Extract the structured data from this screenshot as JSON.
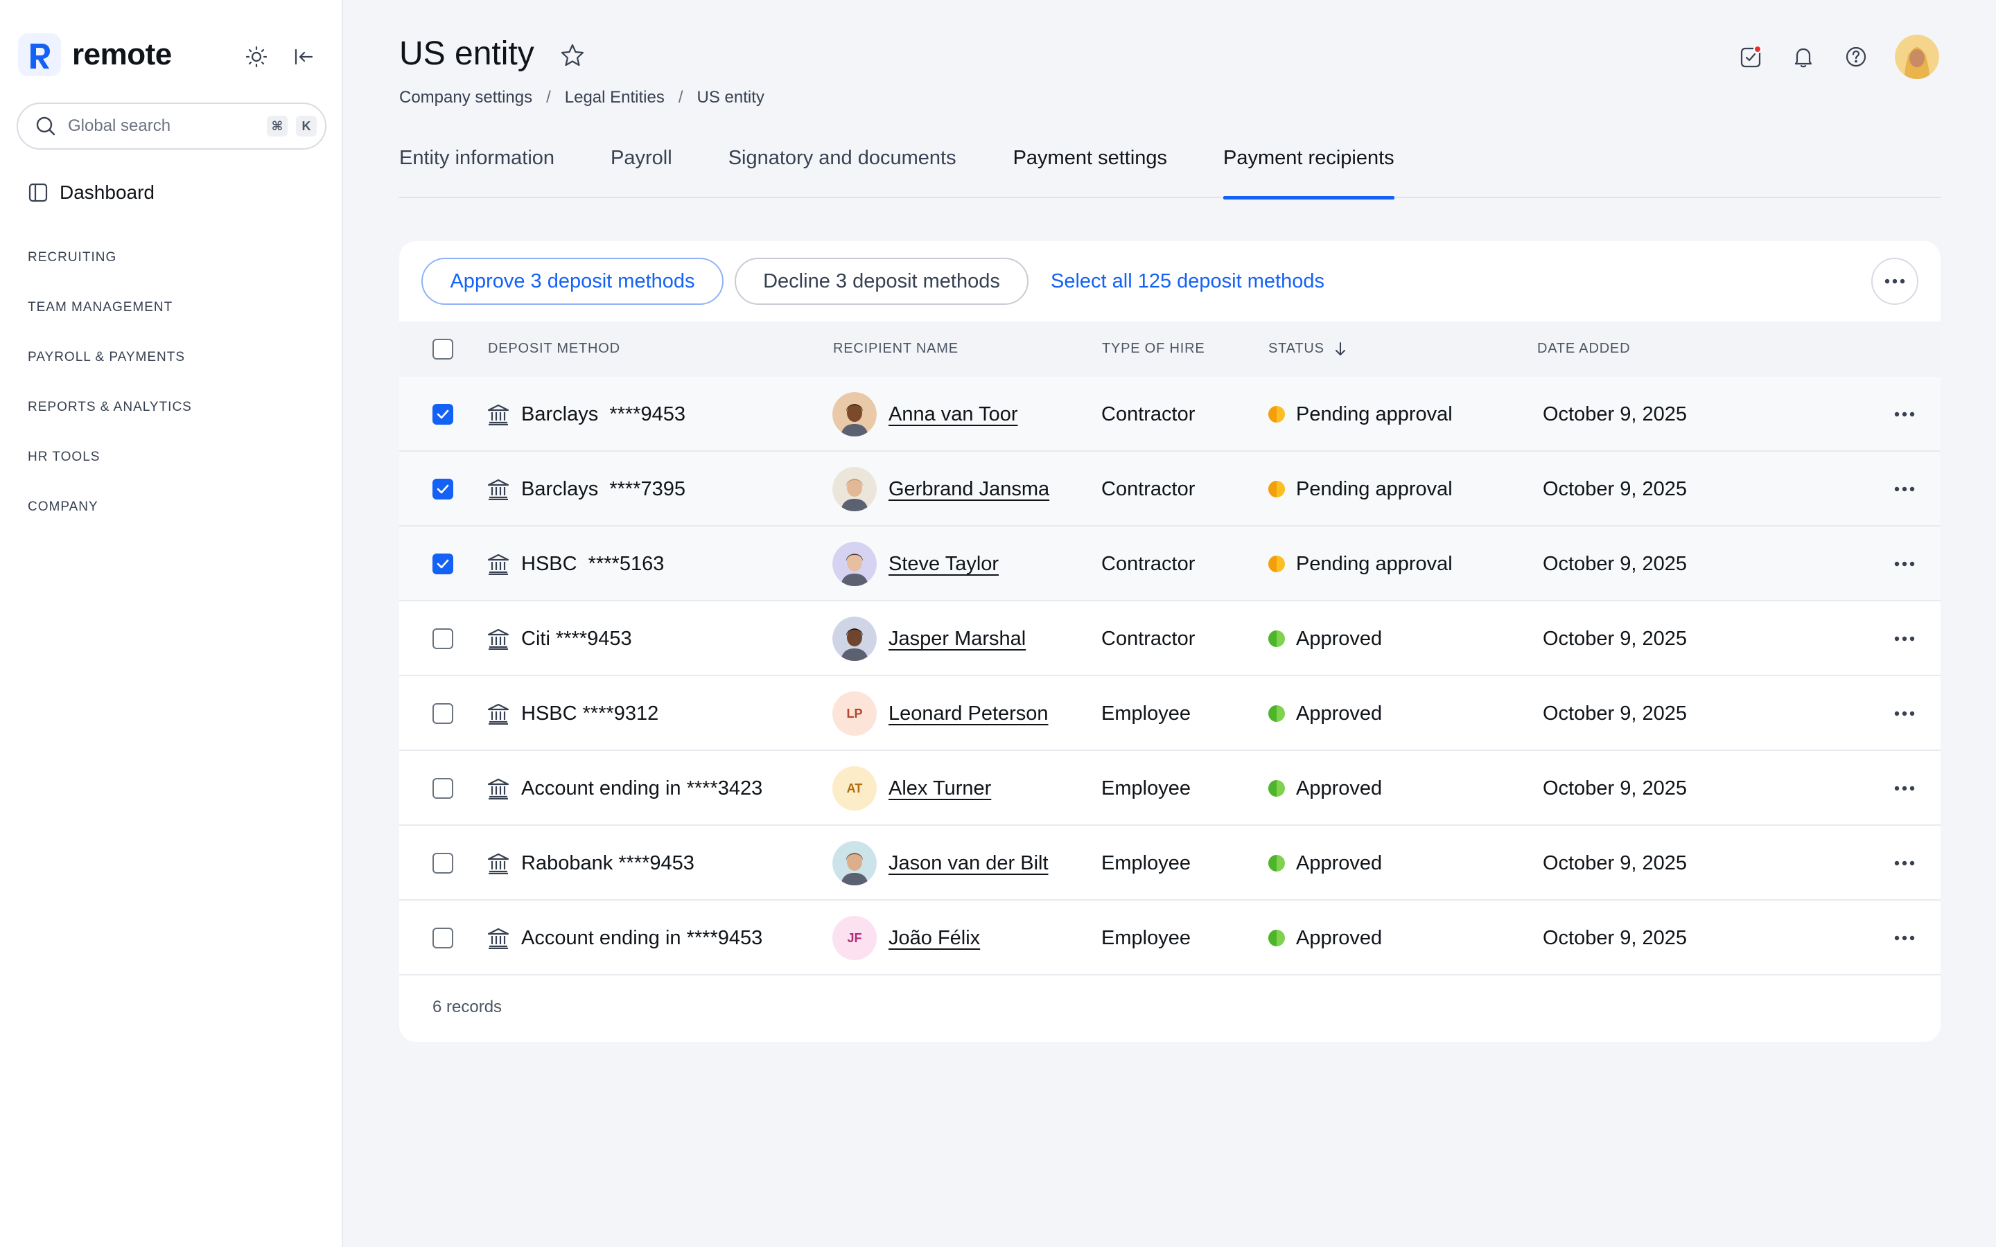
{
  "sidebar": {
    "brand": "remote",
    "search_placeholder": "Global search",
    "search_kbd_cmd": "⌘",
    "search_kbd_key": "K",
    "dashboard": "Dashboard",
    "sections": [
      "RECRUITING",
      "TEAM MANAGEMENT",
      "PAYROLL & PAYMENTS",
      "REPORTS & ANALYTICS",
      "HR TOOLS",
      "COMPANY"
    ]
  },
  "header": {
    "title": "US entity",
    "breadcrumb": [
      "Company settings",
      "Legal Entities",
      "US entity"
    ],
    "breadcrumb_sep": "/"
  },
  "tabs": [
    "Entity information",
    "Payroll",
    "Signatory and documents",
    "Payment settings",
    "Payment recipients"
  ],
  "active_tab": "Payment recipients",
  "actions": {
    "approve": "Approve 3 deposit methods",
    "decline": "Decline 3 deposit methods",
    "select_all": "Select all 125 deposit methods"
  },
  "table": {
    "columns": [
      "DEPOSIT METHOD",
      "RECIPIENT NAME",
      "TYPE OF HIRE",
      "STATUS",
      "DATE ADDED"
    ],
    "rows": [
      {
        "checked": true,
        "deposit": "Barclays  ****9453",
        "name": "Anna van Toor",
        "initials": "",
        "hire": "Contractor",
        "status": "Pending approval",
        "date": "October 9, 2025"
      },
      {
        "checked": true,
        "deposit": "Barclays  ****7395",
        "name": "Gerbrand Jansma",
        "initials": "",
        "hire": "Contractor",
        "status": "Pending approval",
        "date": "October 9, 2025"
      },
      {
        "checked": true,
        "deposit": "HSBC  ****5163",
        "name": "Steve Taylor",
        "initials": "",
        "hire": "Contractor",
        "status": "Pending approval",
        "date": "October 9, 2025"
      },
      {
        "checked": false,
        "deposit": "Citi ****9453",
        "name": "Jasper Marshal",
        "initials": "",
        "hire": "Contractor",
        "status": "Approved",
        "date": "October 9, 2025"
      },
      {
        "checked": false,
        "deposit": "HSBC ****9312",
        "name": "Leonard Peterson",
        "initials": "LP",
        "hire": "Employee",
        "status": "Approved",
        "date": "October 9, 2025"
      },
      {
        "checked": false,
        "deposit": "Account ending in ****3423",
        "name": "Alex Turner",
        "initials": "AT",
        "hire": "Employee",
        "status": "Approved",
        "date": "October 9, 2025"
      },
      {
        "checked": false,
        "deposit": "Rabobank ****9453",
        "name": "Jason van der Bilt",
        "initials": "",
        "hire": "Employee",
        "status": "Approved",
        "date": "October 9, 2025"
      },
      {
        "checked": false,
        "deposit": "Account ending in ****9453",
        "name": "João Félix",
        "initials": "JF",
        "hire": "Employee",
        "status": "Approved",
        "date": "October 9, 2025"
      }
    ],
    "records": "6 records"
  },
  "colors": {
    "accent": "#1462f5",
    "pending": "#f59e0b",
    "approved": "#4cb52a"
  }
}
